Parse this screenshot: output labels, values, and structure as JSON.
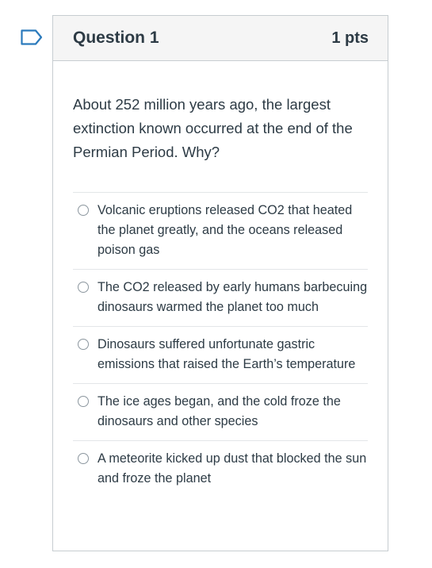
{
  "question": {
    "title": "Question 1",
    "points": "1 pts",
    "text": "About 252 million years ago, the largest extinction known occurred at the end of the Permian Period. Why?",
    "answers": [
      {
        "label": "Volcanic eruptions released CO2 that heated the planet greatly, and the oceans released poison gas",
        "selected": false
      },
      {
        "label": "The CO2 released by early humans barbecuing dinosaurs warmed the planet too much",
        "selected": false
      },
      {
        "label": "Dinosaurs suffered unfortunate gastric emissions that raised the Earth’s temperature",
        "selected": false
      },
      {
        "label": "The ice ages began, and the cold froze the dinosaurs and other species",
        "selected": false
      },
      {
        "label": "A meteorite kicked up dust that blocked the sun and froze the planet",
        "selected": false
      }
    ]
  },
  "colors": {
    "flag": "#2b7abc",
    "text": "#2d3b45",
    "header_bg": "#f5f5f5",
    "border": "#c7cdd1"
  },
  "icons": {
    "flag": "flag-icon",
    "radio": "radio-unchecked-icon"
  }
}
